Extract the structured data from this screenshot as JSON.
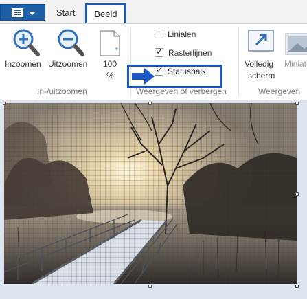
{
  "ribbon": {
    "tabs": {
      "file_menu": "",
      "start": "Start",
      "view": "Beeld"
    },
    "zoom_group": {
      "zoom_in": "Inzoomen",
      "zoom_out": "Uitzoomen",
      "zoom_100_line1": "100",
      "zoom_100_line2": "%",
      "label": "In-/uitzoomen"
    },
    "show_hide_group": {
      "rulers": {
        "label": "Linialen",
        "checked": false
      },
      "gridlines": {
        "label": "Rasterlijnen",
        "checked": true
      },
      "statusbar": {
        "label": "Statusbalk",
        "checked": true
      },
      "label": "Weergeven of verbergen"
    },
    "display_group": {
      "fullscreen_line1": "Volledig",
      "fullscreen_line2": "scherm",
      "thumbnail": "Miniatu",
      "label": "Weergeven"
    }
  },
  "colors": {
    "accent": "#1a56c4",
    "file_button": "#1f5fa8",
    "canvas_bg": "#dbe4ef"
  },
  "icons": [
    "file-menu-icon",
    "zoom-in-icon",
    "zoom-out-icon",
    "page-icon",
    "fullscreen-icon",
    "thumbnail-icon",
    "arrow-icon"
  ]
}
